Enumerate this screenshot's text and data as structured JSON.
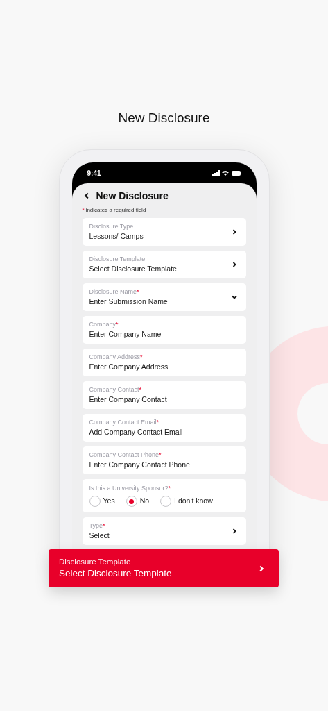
{
  "page_title": "New Disclosure",
  "status_bar": {
    "time": "9:41"
  },
  "screen": {
    "title": "New Disclosure",
    "note": {
      "mark": "*",
      "text": "indicates a required field"
    },
    "fields": [
      {
        "kind": "select",
        "label": "Disclosure Type",
        "value": "Lessons/ Camps"
      },
      {
        "kind": "select",
        "label": "Disclosure Template",
        "value": "Select Disclosure Template"
      },
      {
        "kind": "dropdown",
        "label": "Disclosure Name",
        "required_mark": "*",
        "value": "Enter Submission Name"
      },
      {
        "kind": "text",
        "label": "Company",
        "required_mark": "*",
        "placeholder": "Enter Company Name"
      },
      {
        "kind": "text",
        "label": "Company Address",
        "required_mark": "*",
        "placeholder": "Enter Company Address"
      },
      {
        "kind": "text",
        "label": "Company Contact",
        "required_mark": "*",
        "placeholder": "Enter Company Contact"
      },
      {
        "kind": "text",
        "label": "Company Contact Email",
        "required_mark": "*",
        "placeholder": "Add Company Contact Email"
      },
      {
        "kind": "text",
        "label": "Company Contact Phone",
        "required_mark": "*",
        "placeholder": "Enter Company Contact Phone"
      },
      {
        "kind": "radio",
        "label": "Is this a University Sponsor?",
        "required_mark": "*",
        "options": [
          {
            "label": "Yes",
            "selected": false
          },
          {
            "label": "No",
            "selected": true
          },
          {
            "label": "I don't know",
            "selected": false
          }
        ]
      },
      {
        "kind": "select",
        "label": "Type",
        "required_mark": "*",
        "value": "Select"
      }
    ]
  },
  "callout": {
    "label": "Disclosure Template",
    "value": "Select Disclosure Template"
  }
}
